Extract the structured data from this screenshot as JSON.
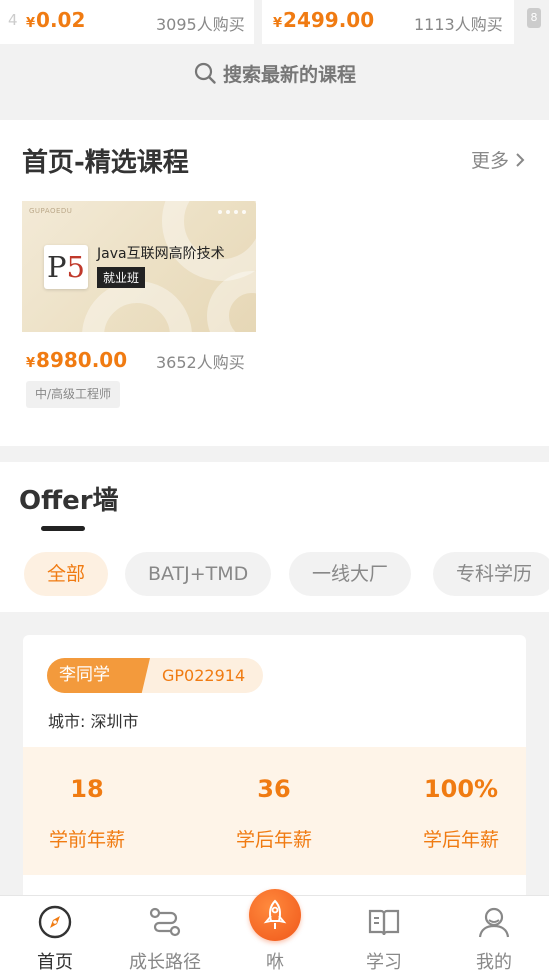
{
  "top_cards": [
    {
      "price_symbol": "¥",
      "price": "0.02",
      "buyers": "3095人购买"
    },
    {
      "price_symbol": "¥",
      "price": "2499.00",
      "buyers": "1113人购买"
    }
  ],
  "edge_left_text": "4",
  "edge_right_text": "8",
  "search": {
    "label": "搜索最新的课程",
    "icon": "search-icon"
  },
  "featured": {
    "title": "首页-精选课程",
    "more_label": "更多",
    "course": {
      "cover_brand": "GUPAOEDU",
      "cover_logo_letter": "P",
      "cover_logo_digit": "5",
      "cover_title": "Java互联网高阶技术",
      "cover_badge": "就业班",
      "price_symbol": "¥",
      "price": "8980.00",
      "buyers": "3652人购买",
      "tag": "中/高级工程师"
    }
  },
  "offer_wall": {
    "title": "Offer墙",
    "filters": [
      {
        "label": "全部",
        "active": true
      },
      {
        "label": "BATJ+TMD",
        "active": false
      },
      {
        "label": "一线大厂",
        "active": false
      },
      {
        "label": "专科学历",
        "active": false
      }
    ],
    "card": {
      "name": "李同学",
      "code": "GP022914",
      "city": "城市: 深圳市",
      "stats": [
        {
          "value": "18",
          "label": "学前年薪"
        },
        {
          "value": "36",
          "label": "学后年薪"
        },
        {
          "value": "100%",
          "label": "学后年薪"
        }
      ]
    }
  },
  "tabbar": {
    "items": [
      {
        "label": "首页",
        "icon": "compass-icon",
        "active": true
      },
      {
        "label": "成长路径",
        "icon": "path-icon",
        "active": false
      },
      {
        "label": "咻",
        "icon": "rocket-icon",
        "active": false
      },
      {
        "label": "学习",
        "icon": "book-icon",
        "active": false
      },
      {
        "label": "我的",
        "icon": "user-icon",
        "active": false
      }
    ]
  },
  "colors": {
    "accent": "#f07b12",
    "accent_light": "#fdf0e1",
    "rocket": "#f0571a"
  }
}
